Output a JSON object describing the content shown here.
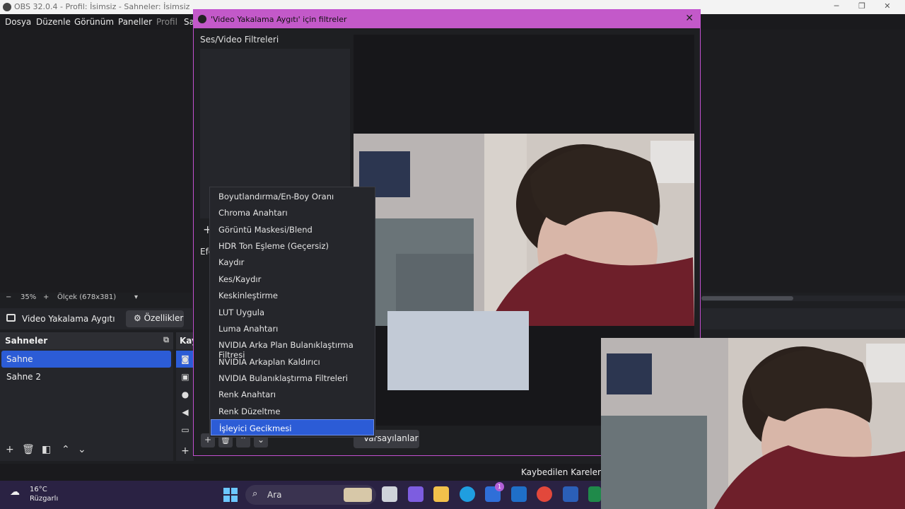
{
  "app": {
    "title": "OBS 32.0.4 - Profil: İsimsiz - Sahneler: İsimsiz",
    "window_controls": [
      "─",
      "❐",
      "✕"
    ]
  },
  "menu": [
    "Dosya",
    "Düzenle",
    "Görünüm",
    "Paneller",
    "Profil",
    "Sa"
  ],
  "zoom": {
    "minus": "−",
    "level": "35%",
    "plus": "+",
    "scale": "Ölçek (678x381)",
    "dropdown": "▾"
  },
  "source_bar": {
    "name": "Video Yakalama Aygıtı",
    "properties": "Özellikler"
  },
  "scenes": {
    "title": "Sahneler",
    "items": [
      "Sahne",
      "Sahne 2"
    ],
    "selected": 0
  },
  "sources_panel": {
    "title": "Kay"
  },
  "status": {
    "lost_frames": "Kaybedilen Kareler 0 (("
  },
  "dialog": {
    "title": "'Video Yakalama Aygıtı' için filtreler",
    "close": "✕",
    "av_filters_label": "Ses/Video Filtreleri",
    "effects_label": "Efe",
    "defaults_button": "Varsayılanlar"
  },
  "context_menu": {
    "items": [
      "Boyutlandırma/En-Boy Oranı",
      "Chroma Anahtarı",
      "Görüntü Maskesi/Blend",
      "HDR Ton Eşleme (Geçersiz)",
      "Kaydır",
      "Kes/Kaydır",
      "Keskinleştirme",
      "LUT Uygula",
      "Luma Anahtarı",
      "NVIDIA Arka Plan Bulanıklaştırma Filtresi",
      "NVIDIA Arkaplan Kaldırıcı",
      "NVIDIA Bulanıklaştırma Filtreleri",
      "Renk Anahtarı",
      "Renk Düzeltme",
      "İşleyici Gecikmesi"
    ],
    "selected": 14
  },
  "taskbar": {
    "weather_temp": "16°C",
    "weather_desc": "Rüzgarlı",
    "search_placeholder": "Ara",
    "notification_badge": "1"
  },
  "colors": {
    "accent": "#2c5cd6",
    "dialog_title": "#c359c9",
    "panel": "#25262b",
    "taskbar": "#2a2243"
  }
}
